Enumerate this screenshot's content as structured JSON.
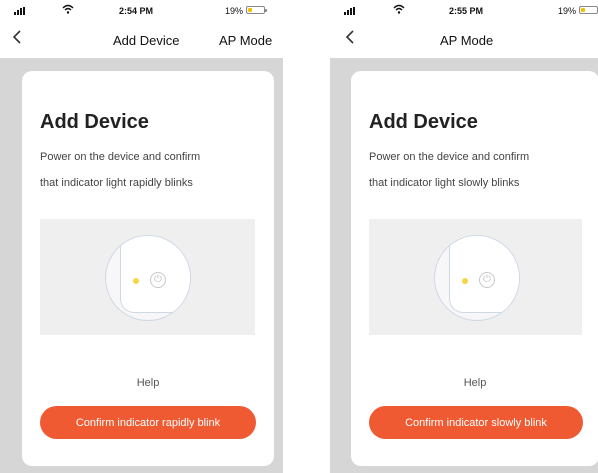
{
  "screens": [
    {
      "status": {
        "time": "2:54 PM",
        "battery": "19%"
      },
      "nav": {
        "back_icon": "chevron-left-icon",
        "title": "Add Device",
        "right_action": "AP Mode"
      },
      "card": {
        "title": "Add Device",
        "line1": "Power on the device and confirm",
        "line2": "that indicator light rapidly blinks",
        "help": "Help",
        "confirm_button": "Confirm indicator rapidly blink"
      }
    },
    {
      "status": {
        "time": "2:55 PM",
        "battery": "19%"
      },
      "nav": {
        "back_icon": "chevron-left-icon",
        "title": "AP Mode"
      },
      "card": {
        "title": "Add Device",
        "line1": "Power on the device and confirm",
        "line2": "that indicator light slowly blinks",
        "help": "Help",
        "confirm_button": "Confirm indicator slowly blink"
      }
    }
  ],
  "colors": {
    "accent": "#f05a32",
    "indicator_led": "#f5d547",
    "battery_fill": "#f2c200",
    "background": "#d6d6d6"
  }
}
